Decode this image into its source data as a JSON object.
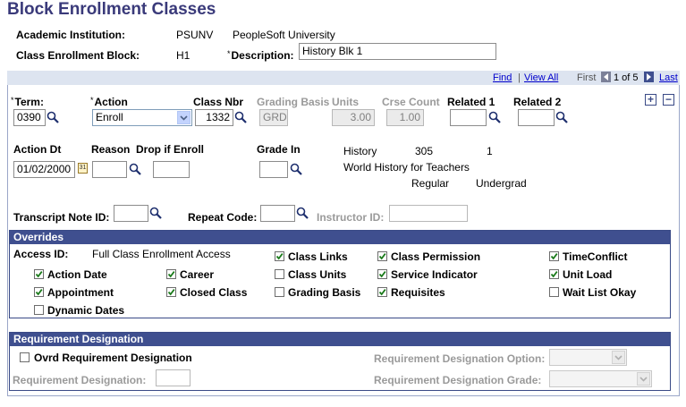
{
  "page": {
    "title": "Block Enrollment Classes"
  },
  "header": {
    "academic_institution_label": "Academic Institution:",
    "academic_institution_code": "PSUNV",
    "academic_institution_name": "PeopleSoft University",
    "class_block_label": "Class Enrollment Block:",
    "class_block_value": "H1",
    "description_label": "Description:",
    "description_value": "History Blk 1"
  },
  "nav": {
    "find": "Find",
    "separator": "|",
    "view_all": "View All",
    "first": "First",
    "counter": "1 of 5",
    "last": "Last"
  },
  "row": {
    "term_label": "Term:",
    "term_value": "0390",
    "action_label": "Action",
    "action_value": "Enroll",
    "class_nbr_label": "Class Nbr",
    "class_nbr_value": "1332",
    "grading_basis_label": "Grading Basis",
    "grading_basis_value": "GRD",
    "units_label": "Units",
    "units_value": "3.00",
    "crse_count_label": "Crse Count",
    "crse_count_value": "1.00",
    "related1_label": "Related 1",
    "related2_label": "Related 2",
    "action_dt_label": "Action Dt",
    "action_dt_value": "01/02/2000",
    "reason_label": "Reason",
    "drop_if_enroll_label": "Drop if Enroll",
    "grade_in_label": "Grade In",
    "course_subject": "History",
    "course_number": "305",
    "course_section": "1",
    "course_title": "World History for Teachers",
    "course_type": "Regular",
    "course_career": "Undergrad",
    "transcript_note_label": "Transcript Note ID:",
    "repeat_code_label": "Repeat Code:",
    "instructor_id_label": "Instructor ID:"
  },
  "overrides": {
    "title": "Overrides",
    "access_id_label": "Access ID:",
    "access_id_value": "Full Class Enrollment Access",
    "items": [
      {
        "label": "Class Links",
        "checked": true
      },
      {
        "label": "Class Permission",
        "checked": true
      },
      {
        "label": "TimeConflict",
        "checked": true
      },
      {
        "label": "Action Date",
        "checked": true
      },
      {
        "label": "Career",
        "checked": true
      },
      {
        "label": "Class Units",
        "checked": false
      },
      {
        "label": "Service Indicator",
        "checked": true
      },
      {
        "label": "Unit Load",
        "checked": true
      },
      {
        "label": "Appointment",
        "checked": true
      },
      {
        "label": "Closed Class",
        "checked": true
      },
      {
        "label": "Grading Basis",
        "checked": false
      },
      {
        "label": "Requisites",
        "checked": true
      },
      {
        "label": "Wait List Okay",
        "checked": false
      },
      {
        "label": "Dynamic Dates",
        "checked": false
      }
    ]
  },
  "requirement": {
    "title": "Requirement Designation",
    "ovrd_label": "Ovrd Requirement Designation",
    "ovrd_checked": false,
    "designation_label": "Requirement Designation:",
    "option_label": "Requirement Designation Option:",
    "grade_label": "Requirement Designation Grade:"
  },
  "colors": {
    "title": "#3a3a7a",
    "bar": "#3f4f8f",
    "navbar": "#dde4f0",
    "link": "#0000cc"
  }
}
